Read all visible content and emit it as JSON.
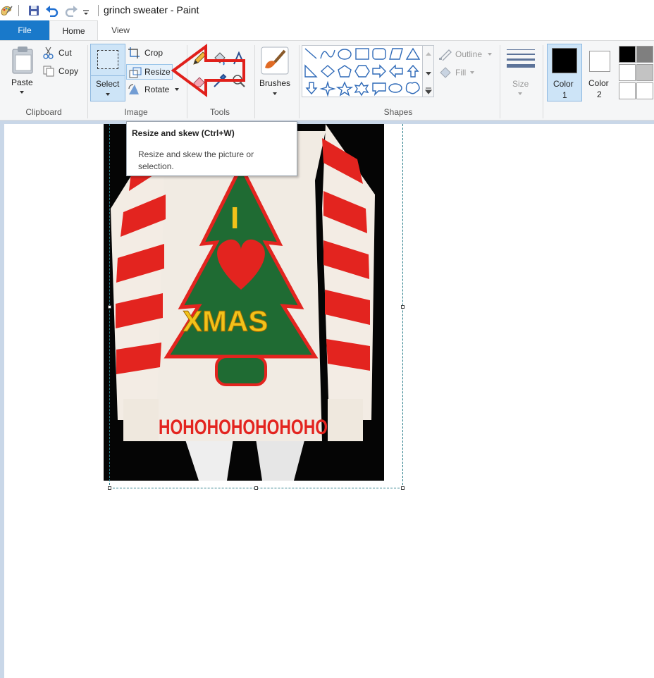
{
  "window": {
    "title": "grinch sweater - Paint"
  },
  "tabs": {
    "file": "File",
    "home": "Home",
    "view": "View"
  },
  "clipboard": {
    "paste": "Paste",
    "cut": "Cut",
    "copy": "Copy",
    "group": "Clipboard"
  },
  "image": {
    "select": "Select",
    "crop": "Crop",
    "resize": "Resize",
    "rotate": "Rotate",
    "group": "Image"
  },
  "tools": {
    "group": "Tools"
  },
  "brushes": {
    "label": "Brushes"
  },
  "shapes": {
    "outline": "Outline",
    "fill": "Fill",
    "group": "Shapes"
  },
  "size": {
    "label": "Size"
  },
  "colors": {
    "color1_line1": "Color",
    "color1_line2": "1",
    "color2_line1": "Color",
    "color2_line2": "2",
    "color1_value": "#000000",
    "color2_value": "#ffffff",
    "palette": [
      "#000000",
      "#7f7f7f",
      "#ffffff",
      "#c3c3c3",
      "#ffffff",
      "#ffffff"
    ]
  },
  "tooltip": {
    "title": "Resize and skew (Ctrl+W)",
    "description": "Resize and skew the picture or selection."
  },
  "sweater": {
    "top_letter": "I",
    "tree_text": "XMAS",
    "hem_text": "HOHOHOHOHOHOHO"
  },
  "accent": {
    "arrow": "#e0201b",
    "selected": "#cde4f7"
  }
}
